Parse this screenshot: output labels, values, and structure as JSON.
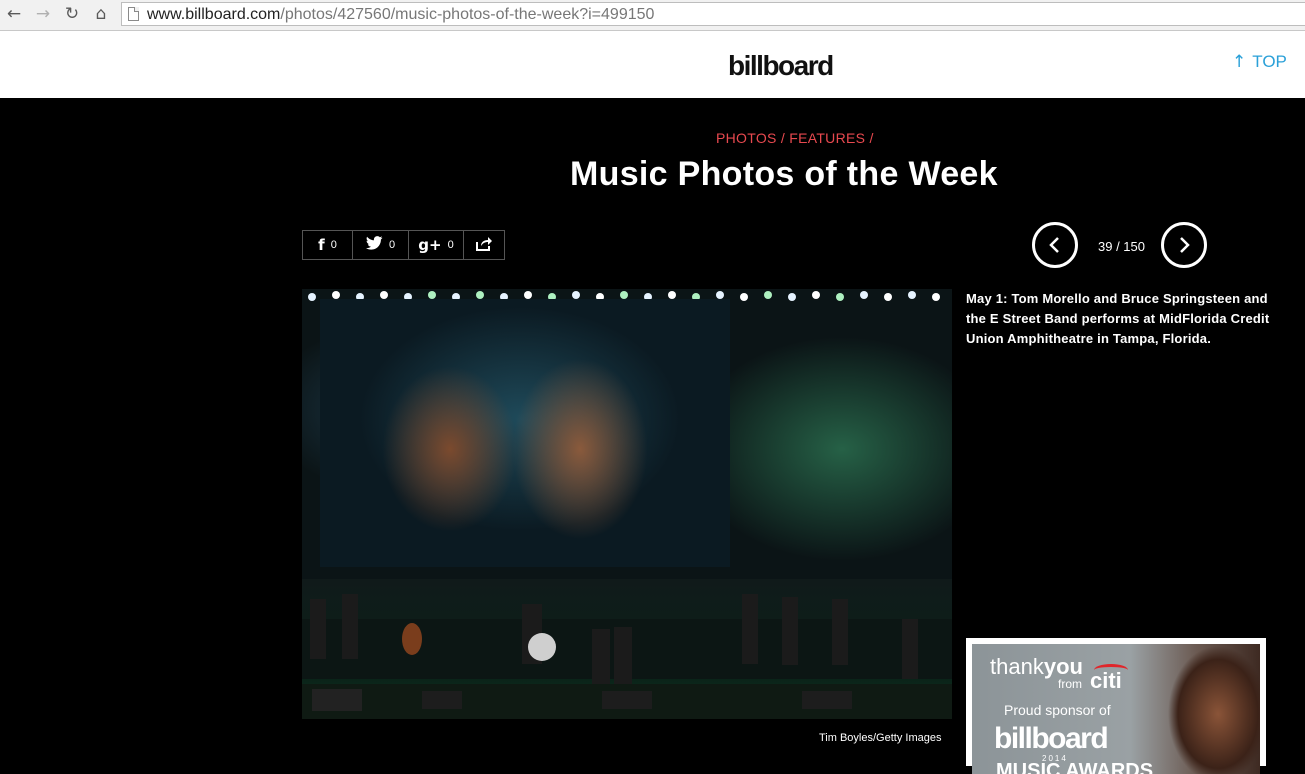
{
  "browser": {
    "back_icon": "←",
    "forward_icon": "→",
    "reload_icon": "↻",
    "home_icon": "⌂",
    "url_host": "www.billboard.com",
    "url_path": "/photos/427560/music-photos-of-the-week?i=499150"
  },
  "header": {
    "logo": "billboard",
    "top_arrow": "↑",
    "top_label": "TOP"
  },
  "article": {
    "breadcrumb": "PHOTOS /  FEATURES /",
    "title": "Music Photos of the Week"
  },
  "share": {
    "facebook_icon": "f",
    "facebook_count": "0",
    "twitter_icon": "t",
    "twitter_count": "0",
    "googleplus_icon": "g+",
    "googleplus_count": "0"
  },
  "pager": {
    "counter": "39 / 150"
  },
  "caption": "May 1:  Tom Morello and Bruce Springsteen and the E Street Band performs at MidFlorida Credit Union Amphitheatre  in Tampa, Florida.",
  "photo_credit": "Tim Boyles/Getty Images",
  "ad": {
    "thank": "thank",
    "you": "you",
    "from": "from",
    "citi": "citi",
    "proud": "Proud sponsor of",
    "logo": "billboard",
    "year": "2014",
    "awards": "MUSIC AWARDS"
  },
  "colors": {
    "accent_red": "#e8494f",
    "top_link_blue": "#2aa0d8",
    "background": "#000000"
  }
}
